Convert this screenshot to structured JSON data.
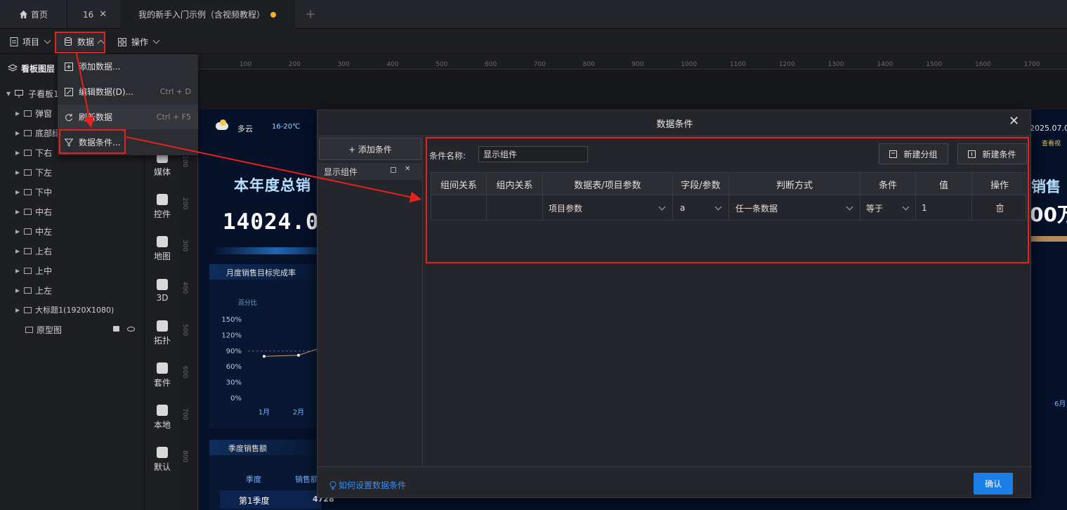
{
  "tabs": [
    {
      "label": "首页"
    },
    {
      "label": "16"
    },
    {
      "label": "我的新手入门示例（含视频教程）"
    }
  ],
  "toolbar": {
    "project": "项目",
    "data": "数据",
    "operation": "操作"
  },
  "menu": {
    "items": [
      {
        "label": "添加数据...",
        "shortcut": ""
      },
      {
        "label": "编辑数据(D)...",
        "shortcut": "Ctrl + D"
      },
      {
        "label": "刷新数据",
        "shortcut": "Ctrl + F5"
      },
      {
        "label": "数据条件...",
        "shortcut": ""
      }
    ]
  },
  "layers": {
    "title": "看板图层",
    "root": "子看板1",
    "items": [
      "弹窗",
      "底部绿",
      "下右",
      "下左",
      "下中",
      "中右",
      "中左",
      "上右",
      "上中",
      "上左",
      "大标题1(1920X1080)",
      "原型图"
    ]
  },
  "components": [
    "媒体",
    "控件",
    "地图",
    "3D",
    "拓扑",
    "套件",
    "本地",
    "默认"
  ],
  "ruler": {
    "top": [
      "100",
      "200",
      "300",
      "400",
      "500",
      "600",
      "700",
      "800",
      "900",
      "1000",
      "1100",
      "1200",
      "1300",
      "1400",
      "1500",
      "1600",
      "1700"
    ],
    "left": [
      "100",
      "200",
      "300",
      "400",
      "500",
      "600",
      "700",
      "800"
    ]
  },
  "dashboard": {
    "weather": "多云",
    "temp": "16-20℃",
    "big_title": "本年度总销",
    "big_value": "14024.0",
    "chart_title": "月度销售目标完成率",
    "chart_ylabel": "百分比",
    "chart_yticks": [
      "150%",
      "120%",
      "90%",
      "60%",
      "30%",
      "0%"
    ],
    "chart_xticks": [
      "1月",
      "2月"
    ],
    "season_title": "季度销售额",
    "season_col1": "季度",
    "season_col2": "销售额",
    "season_row1": "第1季度",
    "season_row1_val": "4728",
    "right_date": "2025.07.0",
    "right_link": "查看视",
    "right_title": "销售",
    "right_value": "00万",
    "right_month": "6月"
  },
  "dialog": {
    "title": "数据条件",
    "add_condition": "+ 添加条件",
    "condition_item": "显示组件",
    "name_label": "条件名称:",
    "name_value": "显示组件",
    "new_group": "新建分组",
    "new_condition": "新建条件",
    "columns": [
      "组间关系",
      "组内关系",
      "数据表/项目参数",
      "字段/参数",
      "判断方式",
      "条件",
      "值",
      "操作"
    ],
    "row": {
      "table": "项目参数",
      "field": "a",
      "method": "任一条数据",
      "cond": "等于",
      "value": "1"
    },
    "help": "如何设置数据条件",
    "confirm": "确认"
  },
  "colors": {
    "accent": "#1a7ee6",
    "highlight": "#e8221a",
    "dirty_dot": "#f0b030"
  },
  "chart_data": {
    "type": "line",
    "title": "月度销售目标完成率",
    "ylabel": "百分比",
    "categories": [
      "1月",
      "2月"
    ],
    "values": [
      80,
      82
    ],
    "ylim": [
      0,
      150
    ],
    "target_line": 90
  }
}
